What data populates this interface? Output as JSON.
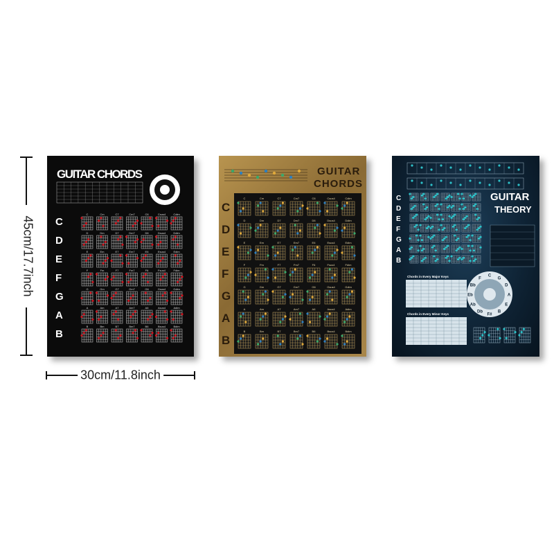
{
  "posters": [
    {
      "title": "GUITAR CHORDS",
      "keys": [
        "C",
        "D",
        "E",
        "F",
        "G",
        "A",
        "B"
      ],
      "chord_rows": [
        [
          "C",
          "Cm",
          "C7",
          "Cm7",
          "C6",
          "Csus4",
          "Cdim"
        ],
        [
          "D",
          "Dm",
          "D7",
          "Dm7",
          "D6",
          "Dsus4",
          "Ddim"
        ],
        [
          "E",
          "Em",
          "E7",
          "Em7",
          "E6",
          "Esus4",
          "Edim"
        ],
        [
          "F",
          "Fm",
          "F7",
          "Fm7",
          "F6",
          "Fsus4",
          "Fdim"
        ],
        [
          "G",
          "Gm",
          "G7",
          "Gm7",
          "G6",
          "Gsus4",
          "Gdim"
        ],
        [
          "A",
          "Am",
          "A7",
          "Am7",
          "A6",
          "Asus4",
          "Adim"
        ],
        [
          "B",
          "Bm",
          "B7",
          "Bm7",
          "B6",
          "Bsus4",
          "Bdim"
        ]
      ],
      "colors": {
        "background": "#0b0b0b",
        "text": "#ffffff",
        "accent": "#c8141e"
      }
    },
    {
      "title_line1": "GUITAR",
      "title_line2": "CHORDS",
      "keys": [
        "C",
        "D",
        "E",
        "F",
        "G",
        "A",
        "B"
      ],
      "chord_rows": [
        [
          "C",
          "Cm",
          "C7",
          "Cm7",
          "C6",
          "Csus4",
          "Cdim"
        ],
        [
          "D",
          "Dm",
          "D7",
          "Dm7",
          "D6",
          "Dsus4",
          "Ddim"
        ],
        [
          "E",
          "Em",
          "E7",
          "Em7",
          "E6",
          "Esus4",
          "Edim"
        ],
        [
          "F",
          "Fm",
          "F7",
          "Fm7",
          "F6",
          "Fsus4",
          "Fdim"
        ],
        [
          "G",
          "Gm",
          "G7",
          "Gm7",
          "G6",
          "Gsus4",
          "Gdim"
        ],
        [
          "A",
          "Am",
          "A7",
          "Am7",
          "A6",
          "Asus4",
          "Adim"
        ],
        [
          "B",
          "Bm",
          "B7",
          "Bm7",
          "B6",
          "Bsus4",
          "Bdim"
        ]
      ],
      "colors": {
        "panel": "#111111",
        "key_text": "#2a1c0c",
        "title": "#2a1c0c",
        "dots": [
          "#3aa86b",
          "#2d7fc0",
          "#e0a93a"
        ]
      }
    },
    {
      "title_line1": "GUITAR",
      "title_line2": "THEORY",
      "keys": [
        "C",
        "D",
        "E",
        "F",
        "G",
        "A",
        "B"
      ],
      "section_major": "Chords in Every Major Keys",
      "section_minor": "Chords in Every Minor Keys",
      "circle_notes": [
        "C",
        "G",
        "D",
        "A",
        "E",
        "B",
        "F#",
        "Db",
        "Ab",
        "Eb",
        "Bb",
        "F"
      ],
      "colors": {
        "background": "#0e2233",
        "text": "#ffffff",
        "dots": "#2ec0c8"
      }
    }
  ],
  "dimensions": {
    "height_label": "45cm/17.7inch",
    "width_label": "30cm/11.8inch"
  }
}
